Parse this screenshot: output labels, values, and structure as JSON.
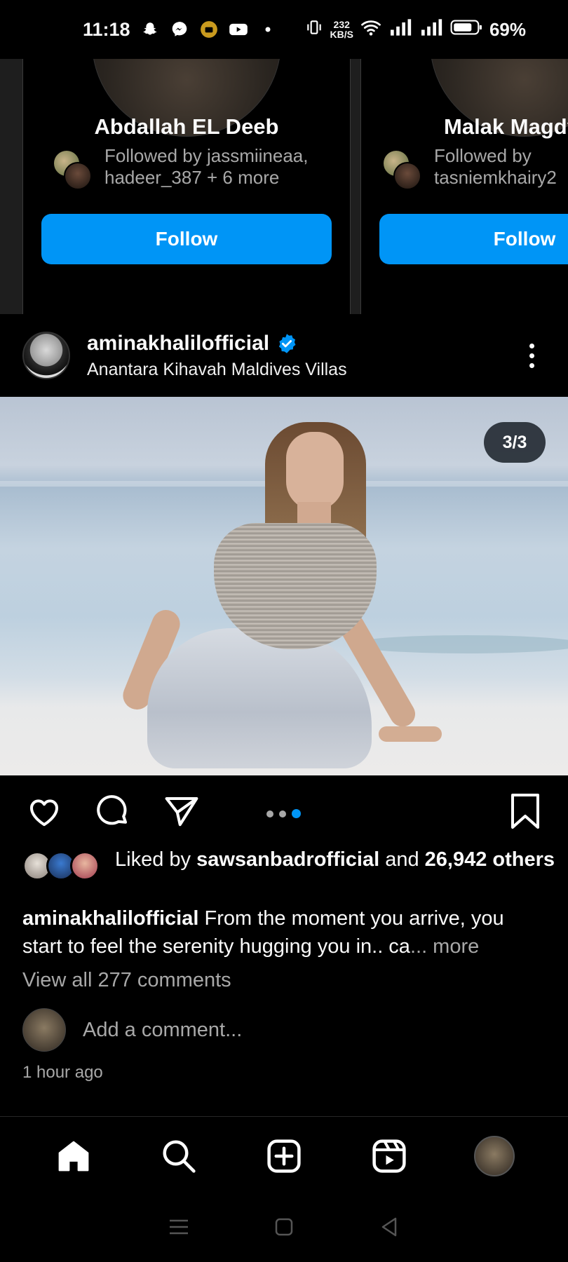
{
  "status_bar": {
    "time": "11:18",
    "net_speed_value": "232",
    "net_speed_unit": "KB/S",
    "battery": "69%"
  },
  "suggestions": [
    {
      "name": "Abdallah EL Deeb",
      "followed_by_line1": "Followed by jassmiineaa,",
      "followed_by_line2": "hadeer_387 + 6 more",
      "button": "Follow"
    },
    {
      "name": "Malak Magdy",
      "followed_by_line1": "Followed by",
      "followed_by_line2": "tasniemkhairy2",
      "button": "Follow"
    }
  ],
  "post": {
    "username": "aminakhalilofficial",
    "location": "Anantara Kihavah Maldives Villas",
    "image_counter": "3/3",
    "likes_prefix": "Liked by ",
    "likes_user": "sawsanbadrofficial",
    "likes_middle": " and ",
    "likes_count": "26,942",
    "likes_suffix": " others",
    "caption_user": "aminakhalilofficial",
    "caption_text": " From the moment you arrive, you start to feel the serenity hugging you in.. ca",
    "caption_more": "... more",
    "view_comments": "View all 277 comments",
    "add_comment_placeholder": "Add a comment...",
    "timestamp": "1 hour ago"
  },
  "colors": {
    "accent": "#0095f6",
    "background": "#000000",
    "secondary_text": "#a8a8a8"
  }
}
